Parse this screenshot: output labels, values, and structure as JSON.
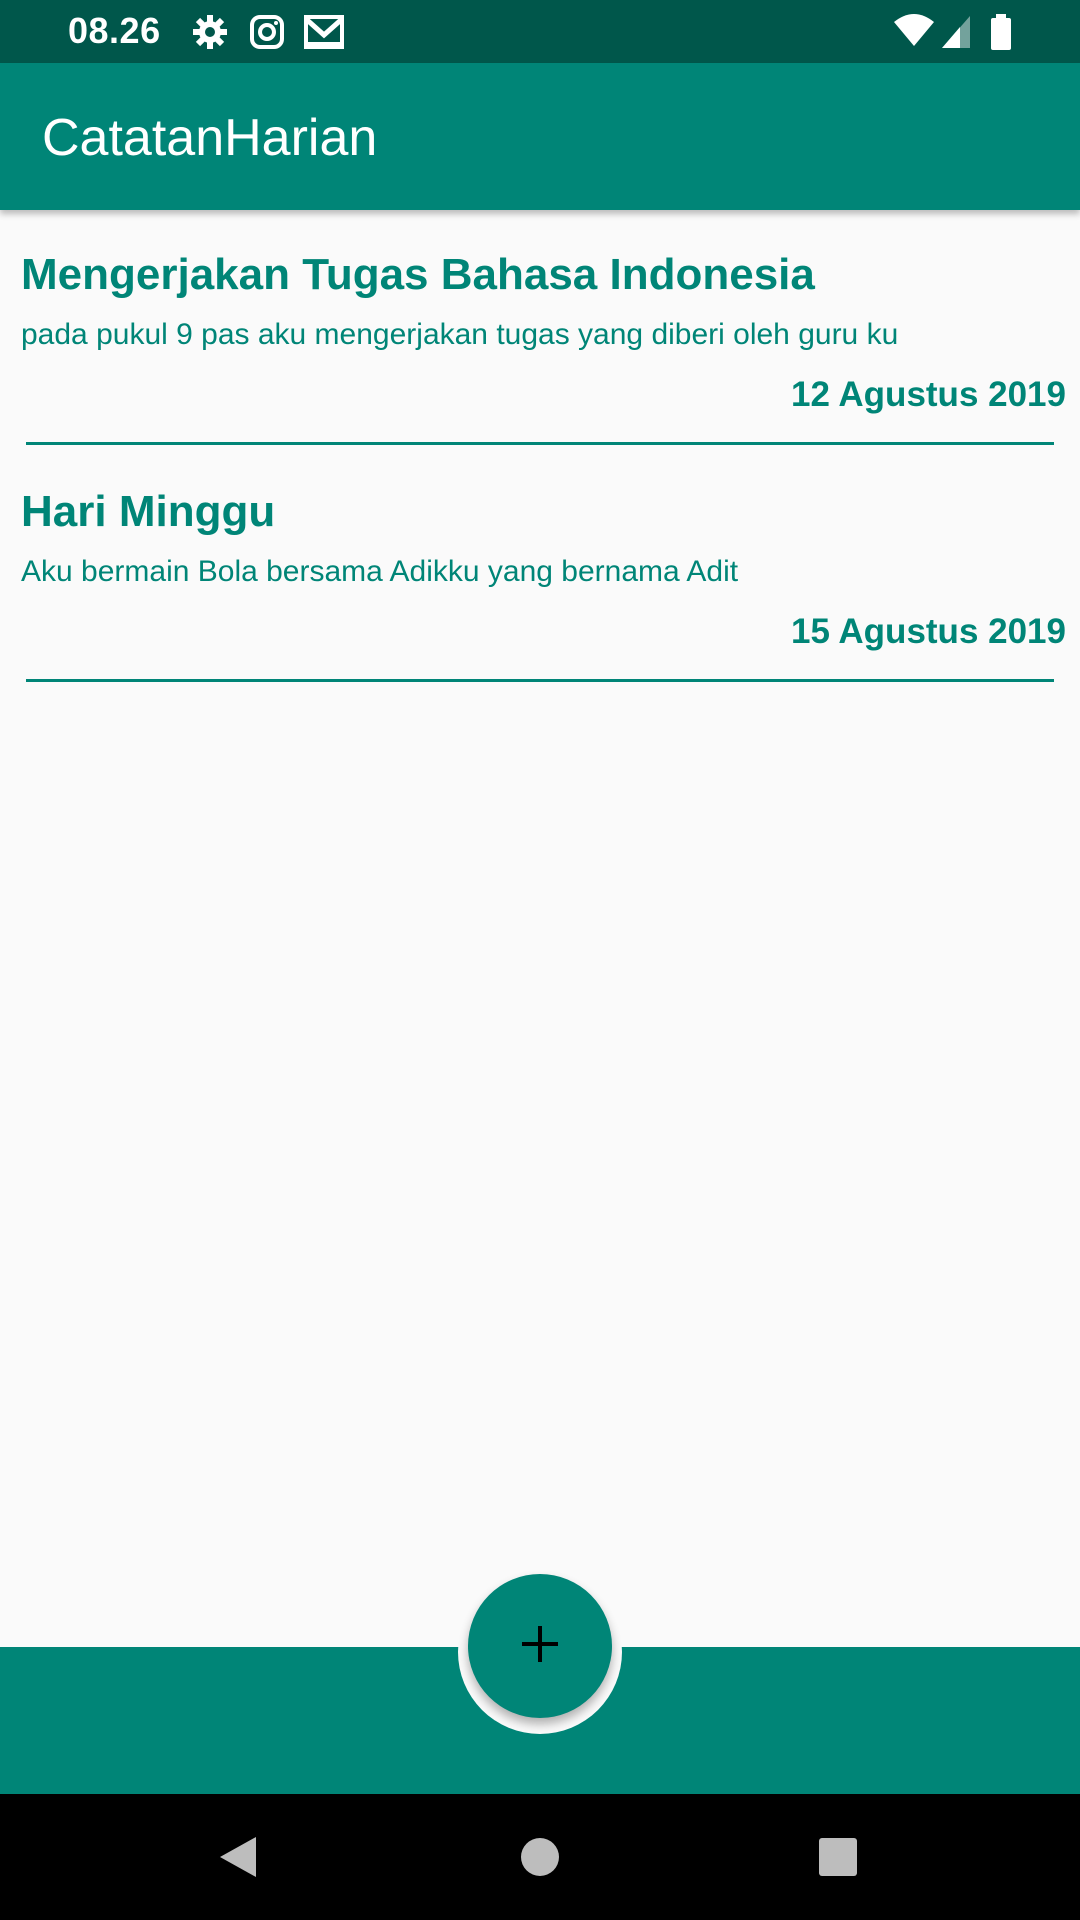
{
  "status_bar": {
    "time": "08.26",
    "left_icons": [
      "gear-icon",
      "instagram-icon",
      "gmail-icon"
    ],
    "right_icons": [
      "wifi-icon",
      "cellular-signal-icon",
      "battery-icon"
    ],
    "background_color": "#00574B"
  },
  "app_bar": {
    "title": "CatatanHarian",
    "background_color": "#008577"
  },
  "notes": [
    {
      "title": "Mengerjakan Tugas Bahasa Indonesia",
      "body": "pada pukul 9 pas aku mengerjakan tugas yang diberi oleh guru ku",
      "date": "12 Agustus 2019"
    },
    {
      "title": "Hari Minggu",
      "body": "Aku bermain Bola bersama Adikku yang bernama Adit",
      "date": "15 Agustus 2019"
    }
  ],
  "fab": {
    "icon": "plus-icon"
  },
  "bottom_bar": {
    "background_color": "#008577"
  },
  "nav_bar": {
    "buttons": [
      "back-icon",
      "home-icon",
      "recents-icon"
    ]
  },
  "colors": {
    "accent": "#008577",
    "primary_dark": "#00574B",
    "background": "#FAFAFA"
  }
}
